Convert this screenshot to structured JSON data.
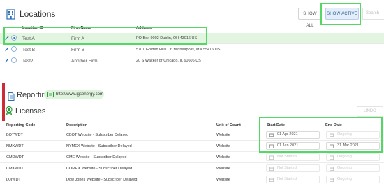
{
  "locations": {
    "title": "Locations",
    "buttons": {
      "show_all": "SHOW ALL",
      "show_active": "SHOW ACTIVE"
    },
    "search_placeholder": "Search",
    "columns": [
      "Location ID",
      "Firm Name",
      "Address"
    ],
    "rows": [
      {
        "id": "Test A",
        "firm": "Firm A",
        "address": "PO Box 9002 Dublin, OH 43016 US",
        "selected": true
      },
      {
        "id": "Test B",
        "firm": "Firm B",
        "address": "5701 Golden Hills Dr. Minneapolis, MN 55416 US",
        "selected": false
      },
      {
        "id": "Test2",
        "firm": "Another Firm",
        "address": "20 S Wacker dr Chicago, IL 60606 US",
        "selected": false
      }
    ]
  },
  "reporting": {
    "label": "Reporting:",
    "link": "http://www.igsenergy.com"
  },
  "licenses": {
    "title": "Licenses",
    "undo_label": "UNDO",
    "columns": [
      "Reporting Code",
      "Description",
      "Unit of Count",
      "Start Date",
      "End Date"
    ],
    "rows": [
      {
        "code": "BOTWDT",
        "desc": "CBOT Website - Subscriber Delayed",
        "unit": "Website",
        "start": "01 Apr 2021",
        "end": "Ongoing",
        "start_muted": false,
        "end_muted": true
      },
      {
        "code": "NMXWDT",
        "desc": "NYMEX Website - Subscriber Delayed",
        "unit": "Website",
        "start": "01 Jan 2021",
        "end": "31 Mar 2021",
        "start_muted": false,
        "end_muted": false
      },
      {
        "code": "CMDWDT",
        "desc": "CME Website - Subscriber Delayed",
        "unit": "Website",
        "start": "Not Started",
        "end": "Ongoing",
        "start_muted": true,
        "end_muted": true
      },
      {
        "code": "CMXWDT",
        "desc": "COMEX Website - Subscriber Delayed",
        "unit": "Website",
        "start": "Not Started",
        "end": "Ongoing",
        "start_muted": true,
        "end_muted": true
      },
      {
        "code": "DJIWDT",
        "desc": "Dow Jones Website - Subscriber Delayed",
        "unit": "Website",
        "start": "Not Started",
        "end": "Ongoing",
        "start_muted": true,
        "end_muted": true
      }
    ]
  },
  "colors": {
    "highlight": "#54d865",
    "accent_red": "#cf2b36",
    "selected_row": "#e2f5e0",
    "link": "#2a70b7"
  },
  "icons": [
    "building-icon",
    "pencil-icon",
    "radio-icon",
    "document-icon",
    "link-icon",
    "badge-icon",
    "calendar-icon"
  ]
}
